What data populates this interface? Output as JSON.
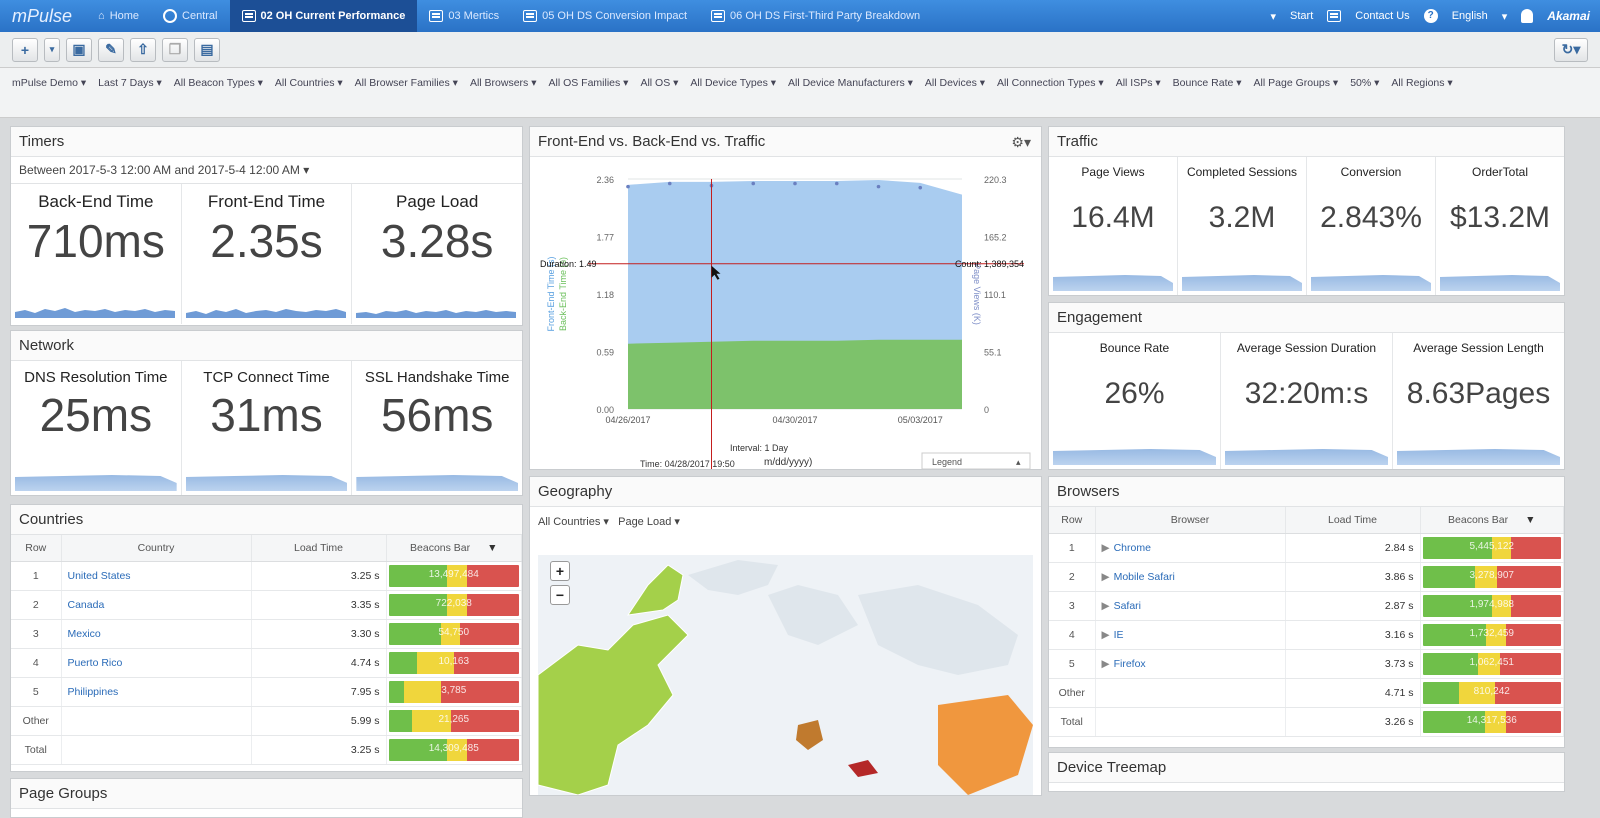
{
  "topnav": {
    "logo": "mPulse",
    "items": [
      {
        "label": "Home",
        "icon": "home-icon"
      },
      {
        "label": "Central",
        "icon": "circle-icon"
      },
      {
        "label": "02 OH Current Performance",
        "icon": "dashboard-icon",
        "active": true
      },
      {
        "label": "03 Mertics",
        "icon": "dashboard-icon"
      },
      {
        "label": "05 OH DS Conversion Impact",
        "icon": "dashboard-icon"
      },
      {
        "label": "06 OH DS First-Third Party Breakdown",
        "icon": "dashboard-icon"
      }
    ],
    "start": "Start",
    "contact": "Contact Us",
    "language": "English",
    "brand": "Akamai"
  },
  "filters": [
    "mPulse Demo ▾",
    "Last 7 Days ▾",
    "All Beacon Types ▾",
    "All Countries ▾",
    "All Browser Families ▾",
    "All Browsers ▾",
    "All OS Families ▾",
    "All OS ▾",
    "All Device Types ▾",
    "All Device Manufacturers ▾",
    "All Devices ▾",
    "All Connection Types ▾",
    "All ISPs ▾",
    "Bounce Rate ▾",
    "All Page Groups ▾",
    "50% ▾",
    "All Regions ▾"
  ],
  "timers": {
    "title": "Timers",
    "range": "Between 2017-5-3 12:00 AM and 2017-5-4 12:00 AM ▾",
    "metrics": [
      {
        "label": "Back-End Time",
        "value": "710ms"
      },
      {
        "label": "Front-End Time",
        "value": "2.35s"
      },
      {
        "label": "Page Load",
        "value": "3.28s"
      }
    ]
  },
  "network": {
    "title": "Network",
    "metrics": [
      {
        "label": "DNS Resolution Time",
        "value": "25ms"
      },
      {
        "label": "TCP Connect Time",
        "value": "31ms"
      },
      {
        "label": "SSL Handshake Time",
        "value": "56ms"
      }
    ]
  },
  "countries": {
    "title": "Countries",
    "headers": [
      "Row",
      "Country",
      "Load Time",
      "Beacons Bar"
    ],
    "rows": [
      {
        "row": "1",
        "name": "United States",
        "load": "3.25 s",
        "beacons": "13,497,484",
        "g": 45,
        "y": 15,
        "r": 40
      },
      {
        "row": "2",
        "name": "Canada",
        "load": "3.35 s",
        "beacons": "722,038",
        "g": 45,
        "y": 15,
        "r": 40
      },
      {
        "row": "3",
        "name": "Mexico",
        "load": "3.30 s",
        "beacons": "54,750",
        "g": 40,
        "y": 15,
        "r": 45
      },
      {
        "row": "4",
        "name": "Puerto Rico",
        "load": "4.74 s",
        "beacons": "10,163",
        "g": 22,
        "y": 28,
        "r": 50
      },
      {
        "row": "5",
        "name": "Philippines",
        "load": "7.95 s",
        "beacons": "3,785",
        "g": 12,
        "y": 28,
        "r": 60
      },
      {
        "row": "Other",
        "name": "",
        "load": "5.99 s",
        "beacons": "21,265",
        "g": 18,
        "y": 30,
        "r": 52
      },
      {
        "row": "Total",
        "name": "",
        "load": "3.25 s",
        "beacons": "14,309,485",
        "g": 45,
        "y": 15,
        "r": 40
      }
    ]
  },
  "fe_chart": {
    "title": "Front-End vs. Back-End vs. Traffic",
    "crosshair_left": "Duration: 1.49",
    "crosshair_right": "Count: 1,389,354",
    "yleft_label": "Front-End Time (s)",
    "yleft2_label": "Back-End Time (s)",
    "yright_label": "Page Views (K)",
    "interval": "Interval: 1 Day",
    "time": "Time: 04/28/2017 19:50",
    "format": "m/dd/yyyy)",
    "legend": "Legend"
  },
  "chart_data": {
    "type": "area",
    "title": "Front-End vs. Back-End vs. Traffic",
    "x": [
      "04/26/2017",
      "04/27/2017",
      "04/28/2017",
      "04/29/2017",
      "04/30/2017",
      "05/01/2017",
      "05/02/2017",
      "05/03/2017",
      "05/04/2017"
    ],
    "x_ticks": [
      "04/26/2017",
      "04/30/2017",
      "05/03/2017"
    ],
    "yleft_ticks": [
      "0.00",
      "0.59",
      "1.18",
      "1.77",
      "2.36"
    ],
    "yright_ticks": [
      "0",
      "55.1",
      "110.1",
      "165.2",
      "220.3"
    ],
    "ylim": [
      0,
      2.36
    ],
    "ylim_right": [
      0,
      220.3
    ],
    "series": [
      {
        "name": "Front-End Time",
        "axis": "left",
        "color": "#a9ccf0",
        "values": [
          2.3,
          2.33,
          2.33,
          2.34,
          2.34,
          2.34,
          2.35,
          2.32,
          2.2
        ]
      },
      {
        "name": "Back-End Time",
        "axis": "left",
        "color": "#7dc26b",
        "values": [
          0.67,
          0.68,
          0.69,
          0.7,
          0.7,
          0.7,
          0.71,
          0.71,
          0.71
        ]
      },
      {
        "name": "Page Views",
        "axis": "right",
        "color": "#6a7fc0",
        "values": [
          213,
          216,
          214,
          216,
          216,
          216,
          213,
          212,
          0
        ]
      }
    ]
  },
  "geography": {
    "title": "Geography",
    "filter1": "All Countries ▾",
    "filter2": "Page Load ▾"
  },
  "traffic": {
    "title": "Traffic",
    "metrics": [
      {
        "label": "Page Views",
        "value": "16.4M"
      },
      {
        "label": "Completed Sessions",
        "value": "3.2M"
      },
      {
        "label": "Conversion",
        "value": "2.843%"
      },
      {
        "label": "OrderTotal",
        "value": "$13.2M"
      }
    ]
  },
  "engagement": {
    "title": "Engagement",
    "metrics": [
      {
        "label": "Bounce Rate",
        "value": "26%"
      },
      {
        "label": "Average Session Duration",
        "value": "32:20m:s"
      },
      {
        "label": "Average Session Length",
        "value": "8.63Pages"
      }
    ]
  },
  "browsers": {
    "title": "Browsers",
    "headers": [
      "Row",
      "Browser",
      "Load Time",
      "Beacons Bar"
    ],
    "rows": [
      {
        "row": "1",
        "name": "Chrome",
        "load": "2.84 s",
        "beacons": "5,445,122",
        "g": 50,
        "y": 14,
        "r": 36
      },
      {
        "row": "2",
        "name": "Mobile Safari",
        "load": "3.86 s",
        "beacons": "3,278,907",
        "g": 38,
        "y": 16,
        "r": 46
      },
      {
        "row": "3",
        "name": "Safari",
        "load": "2.87 s",
        "beacons": "1,974,988",
        "g": 50,
        "y": 14,
        "r": 36
      },
      {
        "row": "4",
        "name": "IE",
        "load": "3.16 s",
        "beacons": "1,732,459",
        "g": 46,
        "y": 14,
        "r": 40
      },
      {
        "row": "5",
        "name": "Firefox",
        "load": "3.73 s",
        "beacons": "1,062,451",
        "g": 40,
        "y": 16,
        "r": 44
      },
      {
        "row": "Other",
        "name": "",
        "load": "4.71 s",
        "beacons": "810,242",
        "g": 26,
        "y": 26,
        "r": 48
      },
      {
        "row": "Total",
        "name": "",
        "load": "3.26 s",
        "beacons": "14,317,536",
        "g": 45,
        "y": 15,
        "r": 40
      }
    ]
  },
  "device": {
    "title": "Device Treemap"
  },
  "pagegroups": {
    "title": "Page Groups"
  }
}
